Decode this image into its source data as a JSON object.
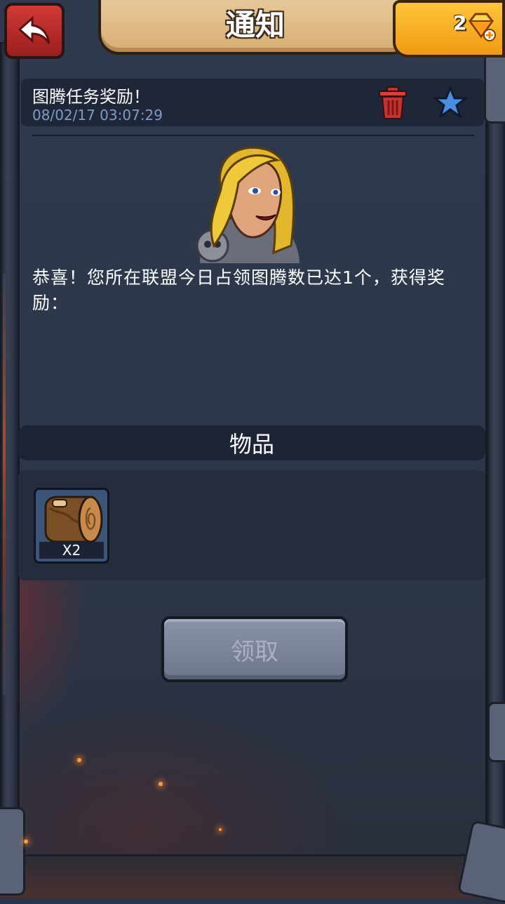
{
  "header": {
    "title": "通知"
  },
  "currency": {
    "gems": "2",
    "icon": "gem-plus-icon",
    "color": "#f5a623"
  },
  "message": {
    "title": "图腾任务奖励！",
    "timestamp": "08/02/17 03:07:29",
    "body": "恭喜！您所在联盟今日占领图腾数已达1个，获得奖励："
  },
  "rewards": {
    "section_title": "物品",
    "items": [
      {
        "icon": "log-icon",
        "quantity": "X2"
      }
    ]
  },
  "claim_button": {
    "label": "领取"
  },
  "colors": {
    "accent": "#d7ae74",
    "danger": "#c8322e",
    "star": "#4a8ee0"
  }
}
